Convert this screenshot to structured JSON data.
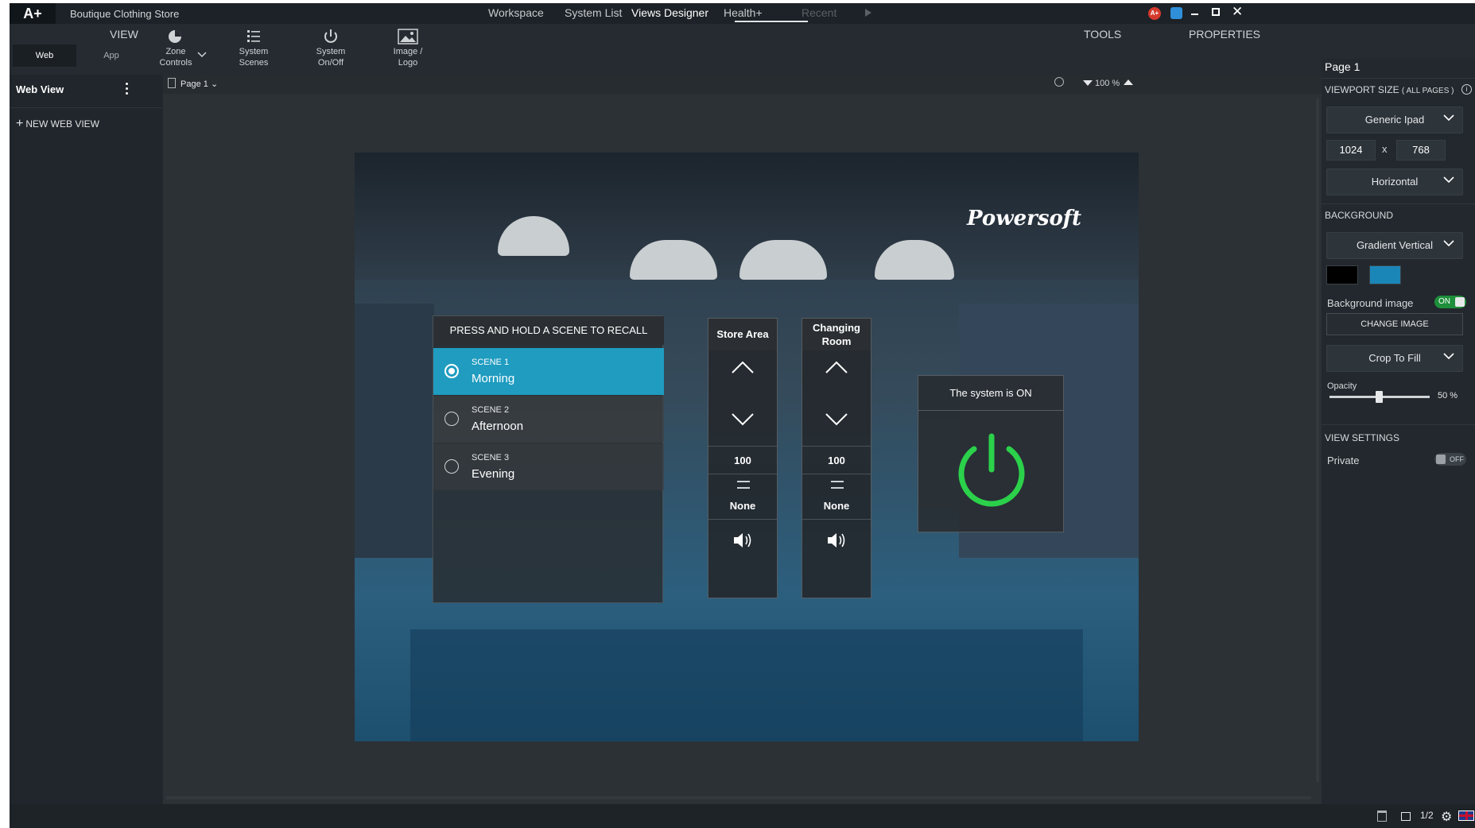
{
  "titlebar": {
    "logo": "A+",
    "title": "Boutique Clothing Store",
    "nav": [
      "Workspace",
      "System List",
      "Views Designer",
      "Health+",
      "Recent"
    ],
    "active_nav": "Views Designer"
  },
  "ribbon": {
    "view_label": "VIEW",
    "tabs": [
      "Web",
      "App"
    ],
    "buttons": [
      {
        "label": "Zone\nControls",
        "icon": "pie-chart-icon"
      },
      {
        "label": "System\nScenes",
        "icon": "list-icon"
      },
      {
        "label": "System\nOn/Off",
        "icon": "power-icon"
      },
      {
        "label": "Image /\nLogo",
        "icon": "image-icon"
      }
    ],
    "tools_label": "TOOLS",
    "properties_label": "PROPERTIES"
  },
  "left_panel": {
    "title": "Web View",
    "new_view": "NEW WEB VIEW"
  },
  "canvas_toolbar": {
    "page_select": "Page 1",
    "zoom": "100 %"
  },
  "stage": {
    "brand": "Powersoft",
    "scenes_header": "PRESS AND HOLD A SCENE TO RECALL",
    "scenes": [
      {
        "label": "SCENE 1",
        "name": "Morning",
        "selected": true
      },
      {
        "label": "SCENE 2",
        "name": "Afternoon",
        "selected": false
      },
      {
        "label": "SCENE 3",
        "name": "Evening",
        "selected": false
      }
    ],
    "zones": [
      {
        "name": "Store Area",
        "level": "100",
        "source": "None"
      },
      {
        "name": "Changing\nRoom",
        "level": "100",
        "source": "None"
      }
    ],
    "power": {
      "status": "The system is ON",
      "color": "#2bd14a"
    },
    "accent": "#1f9cc0"
  },
  "properties": {
    "page": "Page 1",
    "viewport_label": "VIEWPORT SIZE",
    "viewport_scope": "( ALL PAGES )",
    "device": "Generic Ipad",
    "width": "1024",
    "height": "768",
    "x": "x",
    "orientation": "Horizontal",
    "background_label": "BACKGROUND",
    "background_type": "Gradient Vertical",
    "color1": "#000000",
    "color2": "#1a86b8",
    "bg_image_label": "Background image",
    "bg_image_toggle": "ON",
    "change_image": "CHANGE IMAGE",
    "fit": "Crop To Fill",
    "opacity_label": "Opacity",
    "opacity_value": "50 %",
    "opacity": 0.5,
    "view_settings_label": "VIEW SETTINGS",
    "private_label": "Private",
    "private_toggle": "OFF"
  },
  "statusbar": {
    "count": "1/2"
  }
}
